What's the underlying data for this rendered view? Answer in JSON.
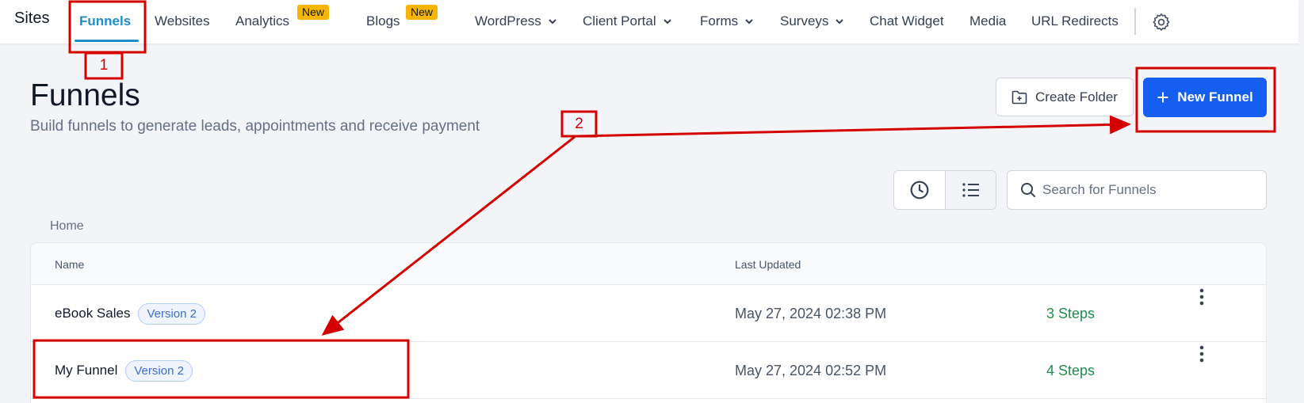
{
  "nav": {
    "brand": "Sites",
    "items": [
      {
        "label": "Funnels"
      },
      {
        "label": "Websites"
      },
      {
        "label": "Analytics",
        "badge": "New"
      },
      {
        "label": "Blogs",
        "badge": "New"
      },
      {
        "label": "WordPress"
      },
      {
        "label": "Client Portal"
      },
      {
        "label": "Forms"
      },
      {
        "label": "Surveys"
      },
      {
        "label": "Chat Widget"
      },
      {
        "label": "Media"
      },
      {
        "label": "URL Redirects"
      }
    ]
  },
  "header": {
    "title": "Funnels",
    "subtitle": "Build funnels to generate leads, appointments and receive payment",
    "create_folder_label": "Create Folder",
    "new_funnel_label": "New Funnel"
  },
  "search": {
    "placeholder": "Search for Funnels"
  },
  "breadcrumb": "Home",
  "table": {
    "columns": {
      "name": "Name",
      "updated": "Last Updated"
    },
    "rows": [
      {
        "name": "eBook Sales",
        "badge": "Version 2",
        "updated": "May 27, 2024 02:38 PM",
        "steps": "3 Steps"
      },
      {
        "name": "My Funnel",
        "badge": "Version 2",
        "updated": "May 27, 2024 02:52 PM",
        "steps": "4 Steps"
      }
    ]
  },
  "annotations": {
    "one": "1",
    "two": "2"
  },
  "colors": {
    "accent": "#1c8fc7",
    "primary_button": "#155eef",
    "new_badge": "#f7b500",
    "steps_text": "#1e8f4e",
    "annotation": "#d40000"
  },
  "icons": [
    "chevron-down-icon",
    "gear-icon",
    "folder-plus-icon",
    "plus-icon",
    "clock-icon",
    "list-icon",
    "search-icon",
    "kebab-menu-icon"
  ]
}
